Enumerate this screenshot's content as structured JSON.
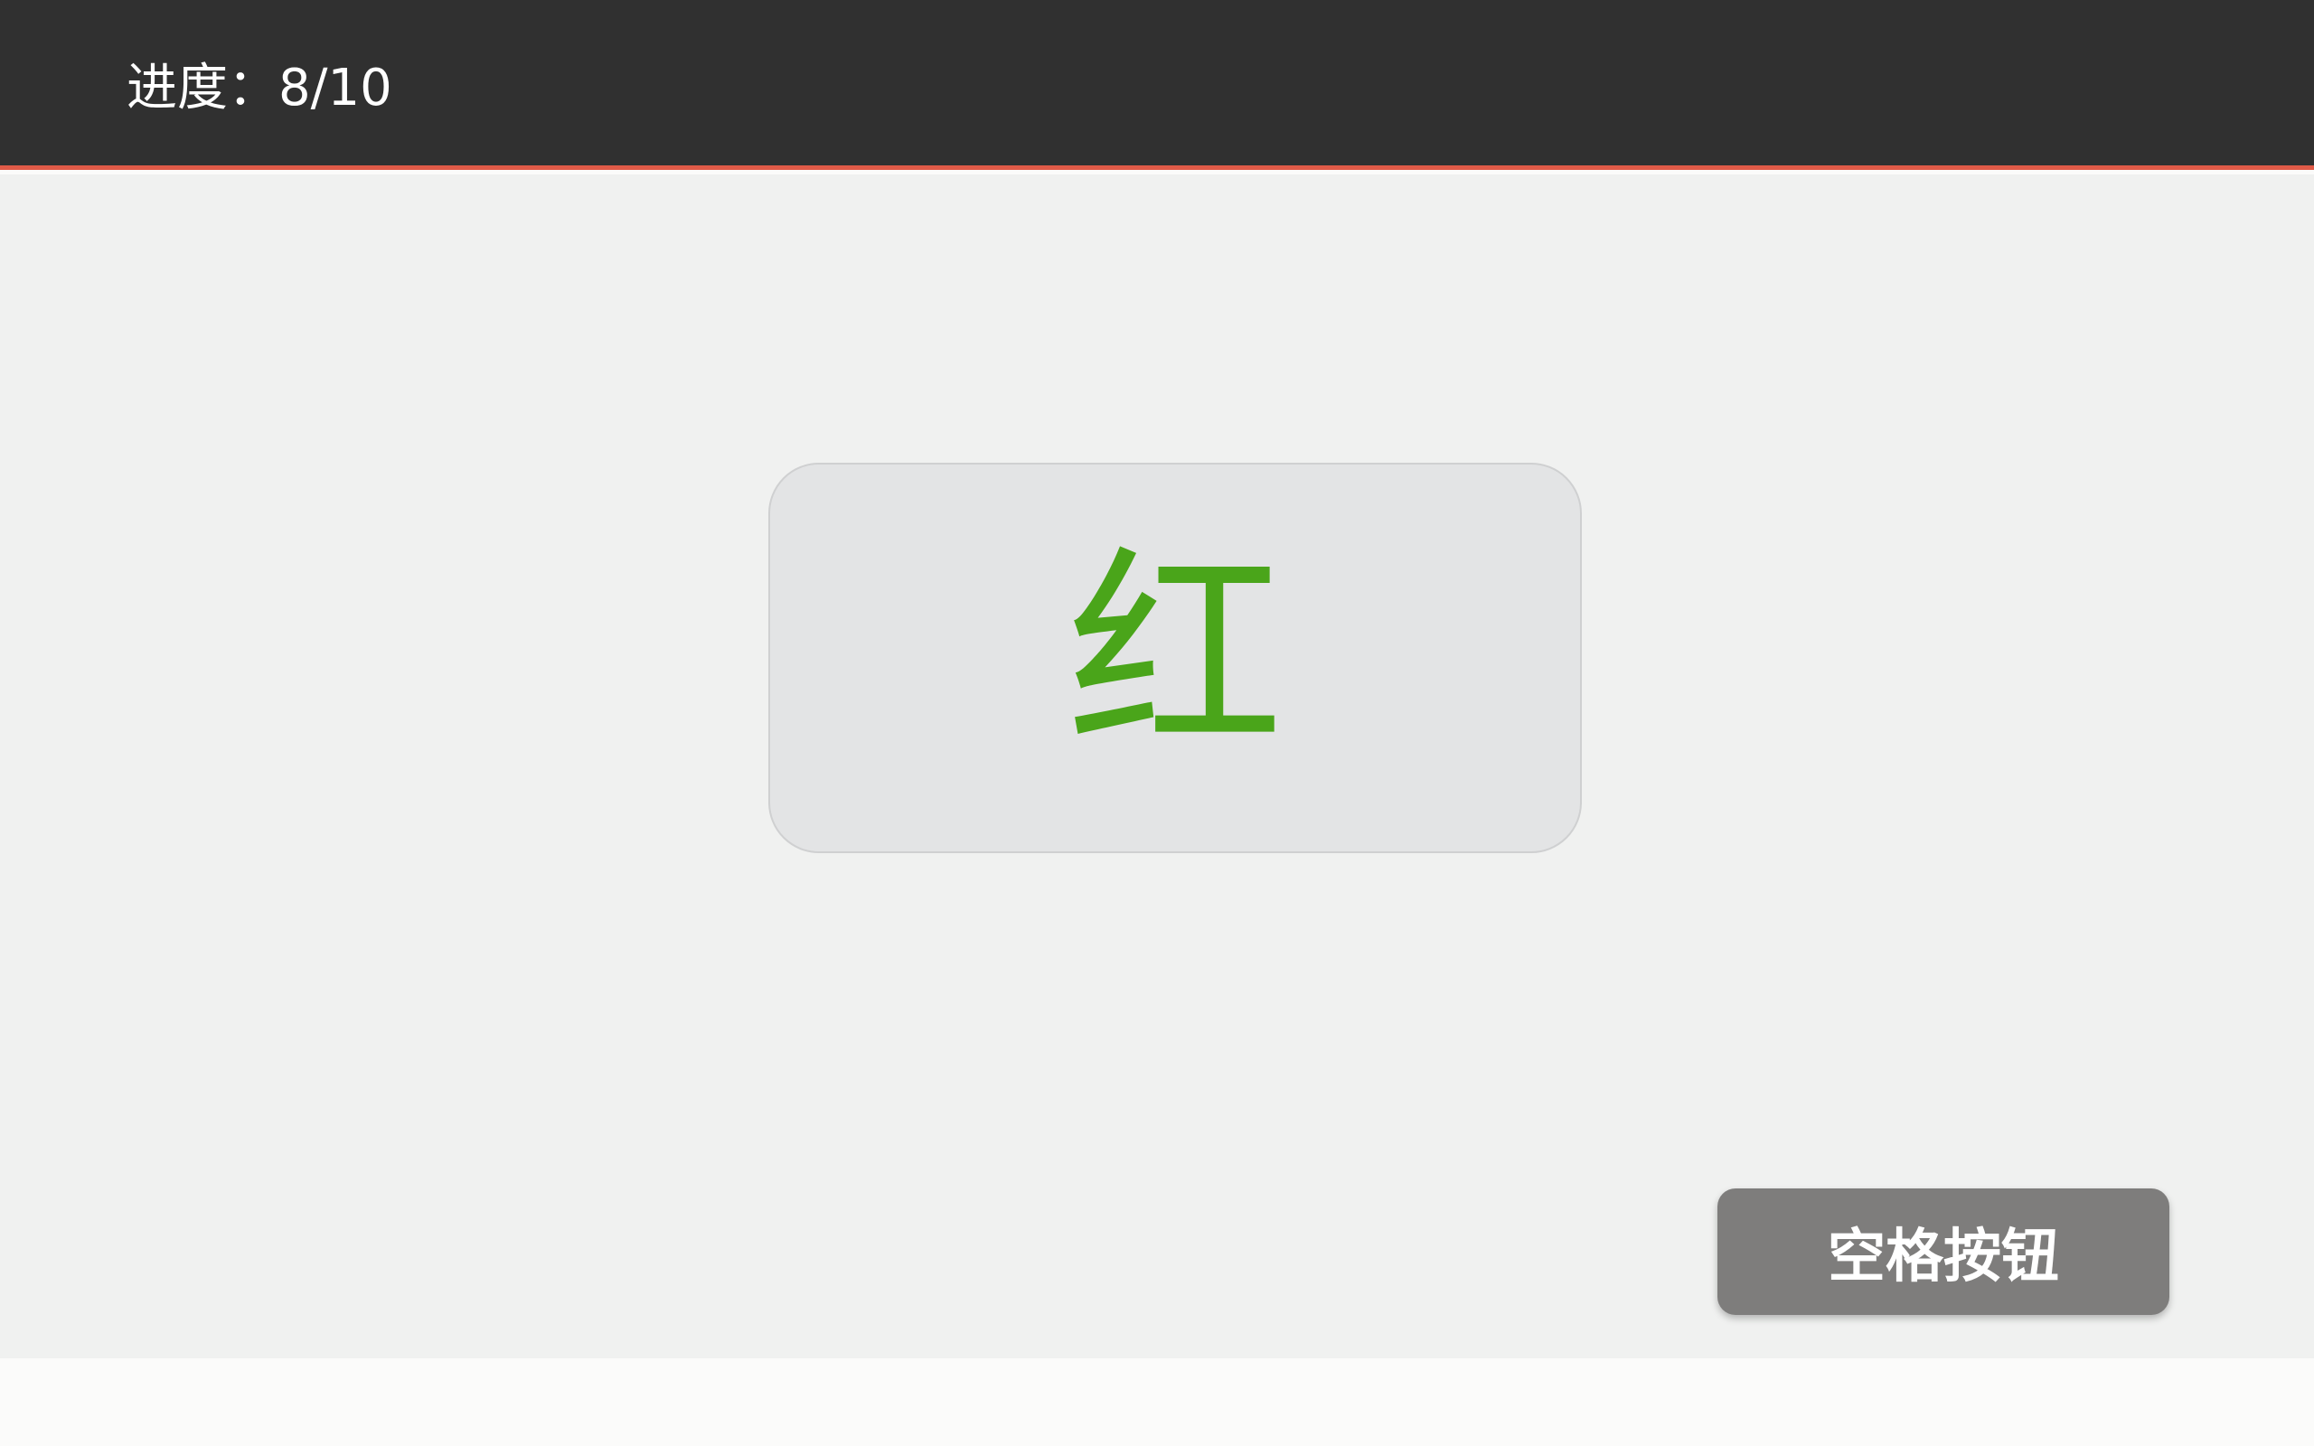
{
  "header": {
    "progress_text": "进度：8/10",
    "bar_color": "#303030",
    "accent_line_color": "#e05a47"
  },
  "stimulus": {
    "word": "红",
    "word_color": "#4aa51a"
  },
  "controls": {
    "space_button_label": "空格按钮"
  }
}
